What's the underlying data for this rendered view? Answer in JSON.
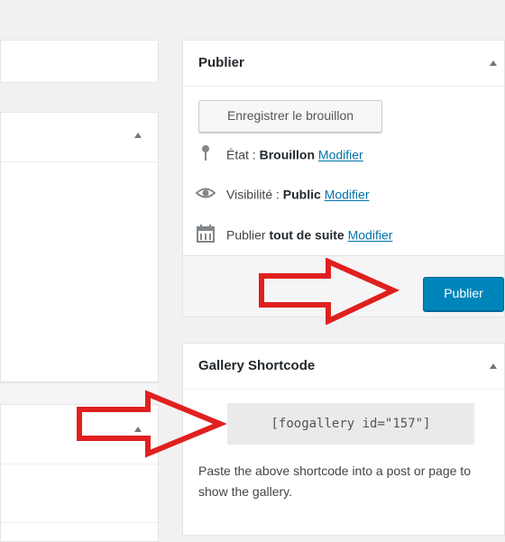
{
  "publish_box": {
    "title": "Publier",
    "save_draft_label": "Enregistrer le brouillon",
    "status": {
      "label": "État :",
      "value": "Brouillon",
      "link": "Modifier"
    },
    "visibility": {
      "label": "Visibilité :",
      "value": "Public",
      "link": "Modifier"
    },
    "schedule": {
      "label": "Publier",
      "value": "tout de suite",
      "link": "Modifier"
    },
    "publish_button": "Publier"
  },
  "gallery_box": {
    "title": "Gallery Shortcode",
    "shortcode": "[foogallery id=\"157\"]",
    "help": "Paste the above shortcode into a post or page to show the gallery."
  },
  "icons": {
    "status": "pin-icon",
    "visibility": "eye-icon",
    "schedule": "calendar-icon",
    "toggle": "triangle-up-icon",
    "annotation": "red-arrow-icon"
  },
  "colors": {
    "accent": "#0085ba",
    "link": "#0073aa",
    "annotation_arrow": "#e0201e"
  }
}
